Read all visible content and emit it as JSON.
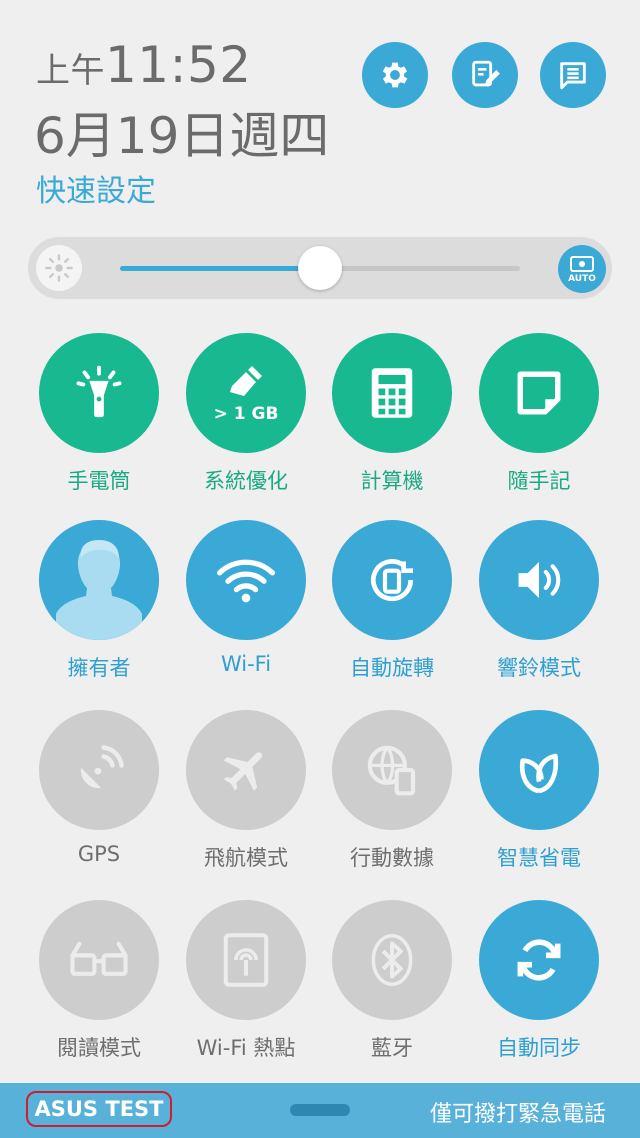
{
  "header": {
    "ampm": "上午",
    "time": "11:52",
    "date": "6月19日週四",
    "section_title": "快速設定",
    "buttons": [
      {
        "icon": "gear-icon"
      },
      {
        "icon": "edit-icon"
      },
      {
        "icon": "notification-list-icon"
      }
    ]
  },
  "brightness": {
    "level": 0.5,
    "auto_label": "AUTO"
  },
  "tiles": [
    {
      "label": "手電筒",
      "icon": "flashlight-icon",
      "state": "green"
    },
    {
      "label": "系統優化",
      "icon": "broom-icon",
      "state": "green",
      "badge": "> 1 GB"
    },
    {
      "label": "計算機",
      "icon": "calculator-icon",
      "state": "green"
    },
    {
      "label": "隨手記",
      "icon": "note-icon",
      "state": "green"
    },
    {
      "label": "擁有者",
      "icon": "user-avatar-icon",
      "state": "blue"
    },
    {
      "label": "Wi-Fi",
      "icon": "wifi-icon",
      "state": "blue"
    },
    {
      "label": "自動旋轉",
      "icon": "auto-rotate-icon",
      "state": "blue"
    },
    {
      "label": "響鈴模式",
      "icon": "volume-icon",
      "state": "blue"
    },
    {
      "label": "GPS",
      "icon": "gps-icon",
      "state": "gray"
    },
    {
      "label": "飛航模式",
      "icon": "airplane-icon",
      "state": "gray"
    },
    {
      "label": "行動數據",
      "icon": "mobile-data-icon",
      "state": "gray"
    },
    {
      "label": "智慧省電",
      "icon": "leaf-icon",
      "state": "blue"
    },
    {
      "label": "閱讀模式",
      "icon": "glasses-icon",
      "state": "gray"
    },
    {
      "label": "Wi-Fi 熱點",
      "icon": "hotspot-icon",
      "state": "gray"
    },
    {
      "label": "藍牙",
      "icon": "bluetooth-icon",
      "state": "gray"
    },
    {
      "label": "自動同步",
      "icon": "sync-icon",
      "state": "blue"
    }
  ],
  "bottom_bar": {
    "carrier": "ASUS TEST",
    "emergency_text": "僅可撥打緊急電話"
  },
  "colors": {
    "accent": "#3aa9d6",
    "green": "#18b990",
    "inactive": "#cdcdcd",
    "highlight_box": "#d11d2a"
  }
}
